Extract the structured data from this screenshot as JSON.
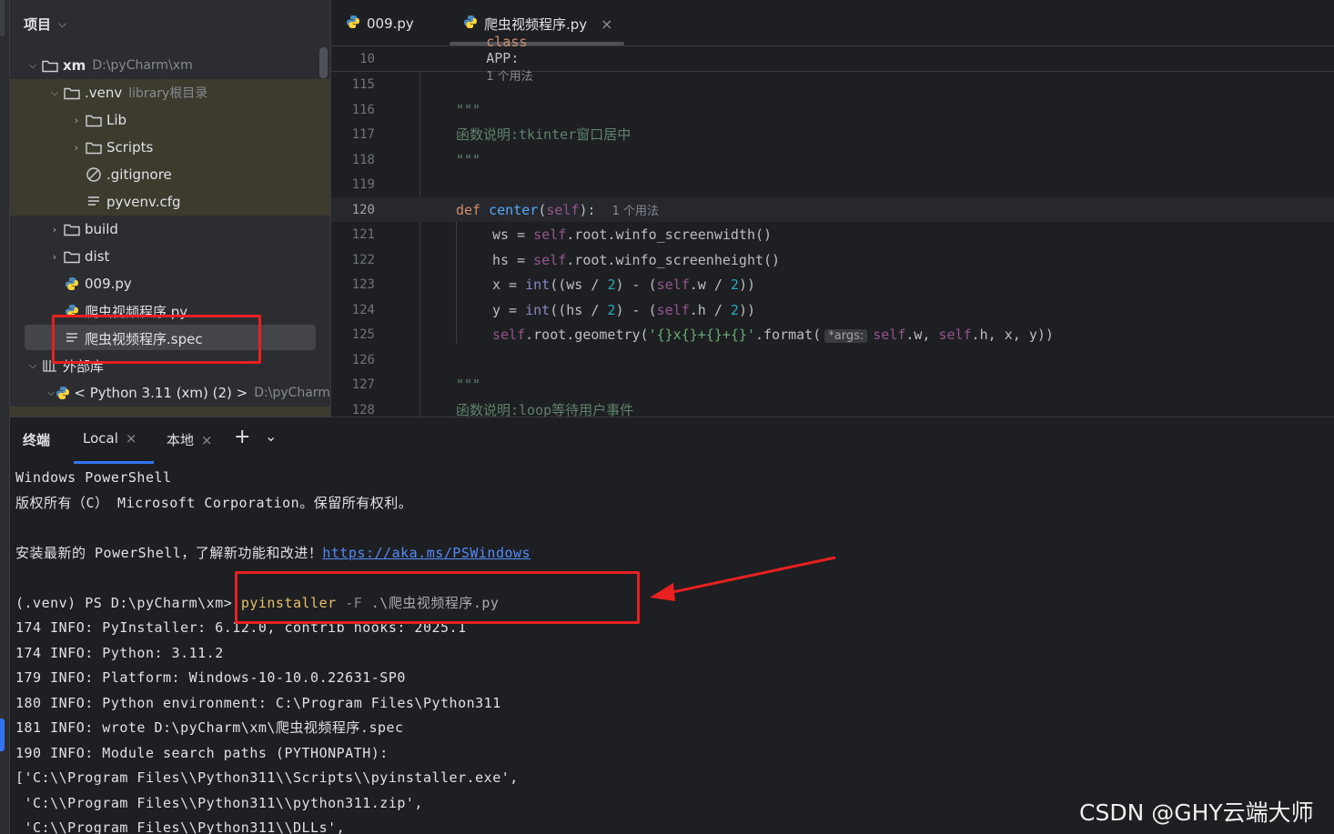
{
  "project": {
    "header": "项目",
    "tree": [
      {
        "label": "xm",
        "sub": "D:\\pyCharm\\xm"
      },
      {
        "label": ".venv",
        "sub": "library根目录"
      },
      {
        "label": "Lib"
      },
      {
        "label": "Scripts"
      },
      {
        "label": ".gitignore"
      },
      {
        "label": "pyvenv.cfg"
      },
      {
        "label": "build"
      },
      {
        "label": "dist"
      },
      {
        "label": "009.py"
      },
      {
        "label": "爬虫视频程序.py"
      },
      {
        "label": "爬虫视频程序.spec"
      },
      {
        "label": "外部库"
      },
      {
        "label": "< Python 3.11 (xm) (2) >",
        "sub": "D:\\pyCharm"
      }
    ]
  },
  "editor": {
    "tabs": [
      {
        "label": "009.py"
      },
      {
        "label": "爬虫视频程序.py"
      }
    ],
    "sticky": {
      "line": "10",
      "keyword": "class",
      "name": "APP:",
      "hint": "1 个用法"
    },
    "lines": [
      {
        "n": "115"
      },
      {
        "n": "116",
        "doc": "\"\"\""
      },
      {
        "n": "117",
        "doc": "函数说明:tkinter窗口居中"
      },
      {
        "n": "118",
        "doc": "\"\"\""
      },
      {
        "n": "119"
      },
      {
        "n": "120",
        "def": "def",
        "fname": "center",
        "open": "(",
        "self": "self",
        "close": "):",
        "hint": "1 个用法"
      },
      {
        "n": "121",
        "text": "ws = ",
        "self": "self",
        "rest": ".root.winfo_screenwidth()"
      },
      {
        "n": "122",
        "text": "hs = ",
        "self": "self",
        "rest": ".root.winfo_screenheight()"
      },
      {
        "n": "123",
        "text": "x = ",
        "builtin": "int",
        "a": "((ws / ",
        "num1": "2",
        "b": ") - (",
        "self": "self",
        "c": ".w / ",
        "num2": "2",
        "d": "))"
      },
      {
        "n": "124",
        "text": "y = ",
        "builtin": "int",
        "a": "((hs / ",
        "num1": "2",
        "b": ") - (",
        "self": "self",
        "c": ".h / ",
        "num2": "2",
        "d": "))"
      },
      {
        "n": "125",
        "self": "self",
        "rest": ".root.geometry(",
        "str": "'{}x{}+{}+{}'",
        "fmt": ".format(",
        "inlay": "*args:",
        "self2": "self",
        "w": ".w, ",
        "self3": "self",
        "h": ".h, x, y))"
      },
      {
        "n": "126"
      },
      {
        "n": "127",
        "doc": "\"\"\""
      },
      {
        "n": "128",
        "doc": "函数说明:loop等待用户事件"
      }
    ]
  },
  "terminal": {
    "title": "终端",
    "tabs": [
      {
        "label": "Local"
      },
      {
        "label": "本地"
      }
    ],
    "add": "+",
    "menu": "⌄",
    "lines": [
      "Windows PowerShell",
      "版权所有（C） Microsoft Corporation。保留所有权利。",
      "",
      "安装最新的 PowerShell，了解新功能和改进！",
      "",
      "(.venv) PS D:\\pyCharm\\xm>",
      "174 INFO: PyInstaller: 6.12.0, contrib hooks: 2025.1",
      "174 INFO: Python: 3.11.2",
      "179 INFO: Platform: Windows-10-10.0.22631-SP0",
      "180 INFO: Python environment: C:\\Program Files\\Python311",
      "181 INFO: wrote D:\\pyCharm\\xm\\爬虫视频程序.spec",
      "190 INFO: Module search paths (PYTHONPATH):",
      "['C:\\\\Program Files\\\\Python311\\\\Scripts\\\\pyinstaller.exe',",
      " 'C:\\\\Program Files\\\\Python311\\\\python311.zip',",
      " 'C:\\\\Program Files\\\\Python311\\\\DLLs',"
    ],
    "link": "https://aka.ms/PSWindows",
    "command": {
      "exe": "pyinstaller",
      "flag": "-F",
      "arg": ".\\爬虫视频程序.py"
    }
  },
  "watermark": "CSDN @GHY云端大师",
  "colors": {
    "annotation_red": "#e8201f",
    "accent_blue": "#3574f0"
  }
}
